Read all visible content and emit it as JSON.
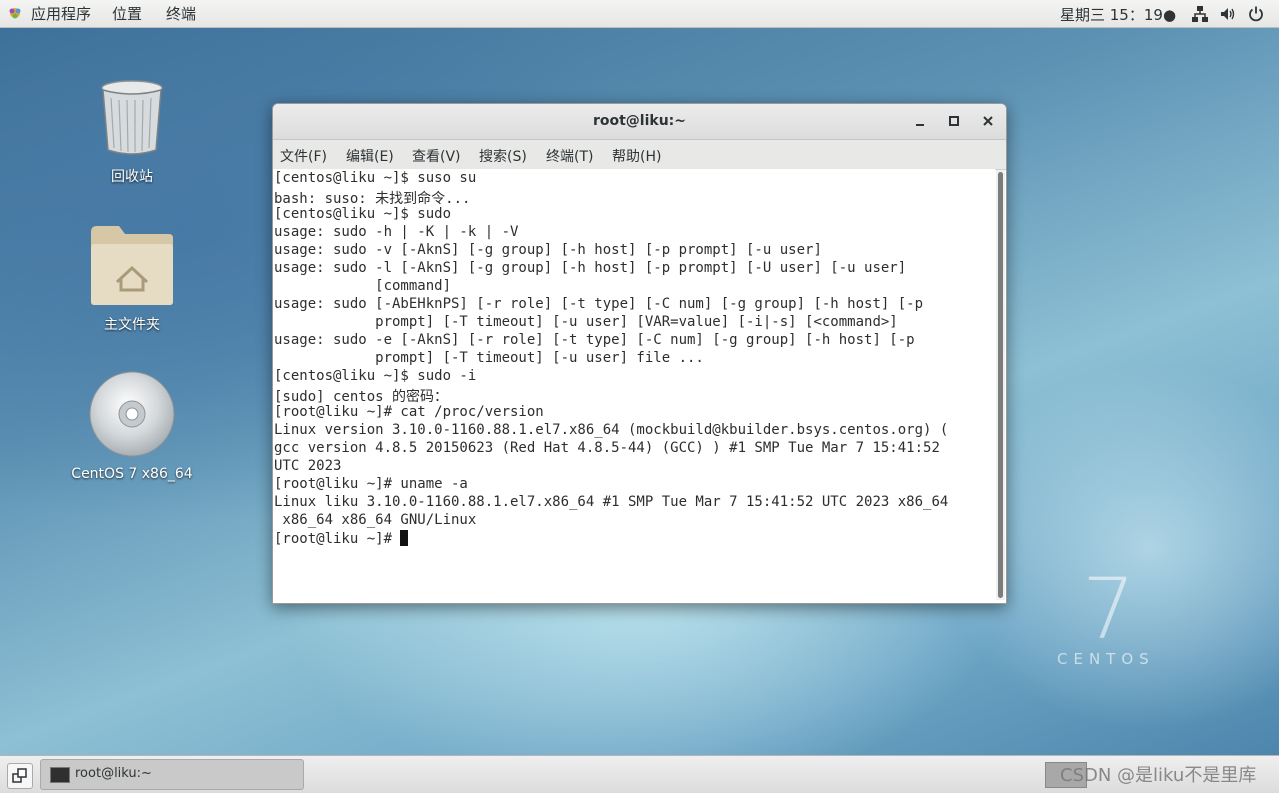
{
  "topbar": {
    "applications": "应用程序",
    "places": "位置",
    "terminal": "终端",
    "clock": "星期三 15：19●"
  },
  "desktop": {
    "icons": [
      {
        "label": "回收站"
      },
      {
        "label": "主文件夹"
      },
      {
        "label": "CentOS 7 x86_64"
      }
    ],
    "brand_number": "7",
    "brand_text": "CENTOS"
  },
  "window": {
    "title": "root@liku:~",
    "menu": [
      "文件(F)",
      "编辑(E)",
      "查看(V)",
      "搜索(S)",
      "终端(T)",
      "帮助(H)"
    ],
    "lines": [
      "[centos@liku ~]$ suso su",
      "bash: suso: 未找到命令...",
      "[centos@liku ~]$ sudo",
      "usage: sudo -h | -K | -k | -V",
      "usage: sudo -v [-AknS] [-g group] [-h host] [-p prompt] [-u user]",
      "usage: sudo -l [-AknS] [-g group] [-h host] [-p prompt] [-U user] [-u user]",
      "            [command]",
      "usage: sudo [-AbEHknPS] [-r role] [-t type] [-C num] [-g group] [-h host] [-p",
      "            prompt] [-T timeout] [-u user] [VAR=value] [-i|-s] [<command>]",
      "usage: sudo -e [-AknS] [-r role] [-t type] [-C num] [-g group] [-h host] [-p",
      "            prompt] [-T timeout] [-u user] file ...",
      "[centos@liku ~]$ sudo -i",
      "[sudo] centos 的密码：",
      "[root@liku ~]# cat /proc/version",
      "Linux version 3.10.0-1160.88.1.el7.x86_64 (mockbuild@kbuilder.bsys.centos.org) (",
      "gcc version 4.8.5 20150623 (Red Hat 4.8.5-44) (GCC) ) #1 SMP Tue Mar 7 15:41:52",
      "UTC 2023",
      "[root@liku ~]# uname -a",
      "Linux liku 3.10.0-1160.88.1.el7.x86_64 #1 SMP Tue Mar 7 15:41:52 UTC 2023 x86_64",
      " x86_64 x86_64 GNU/Linux"
    ],
    "prompt": "[root@liku ~]# "
  },
  "taskbar": {
    "task_label": "root@liku:~",
    "watermark": "CSDN @是liku不是里库"
  }
}
